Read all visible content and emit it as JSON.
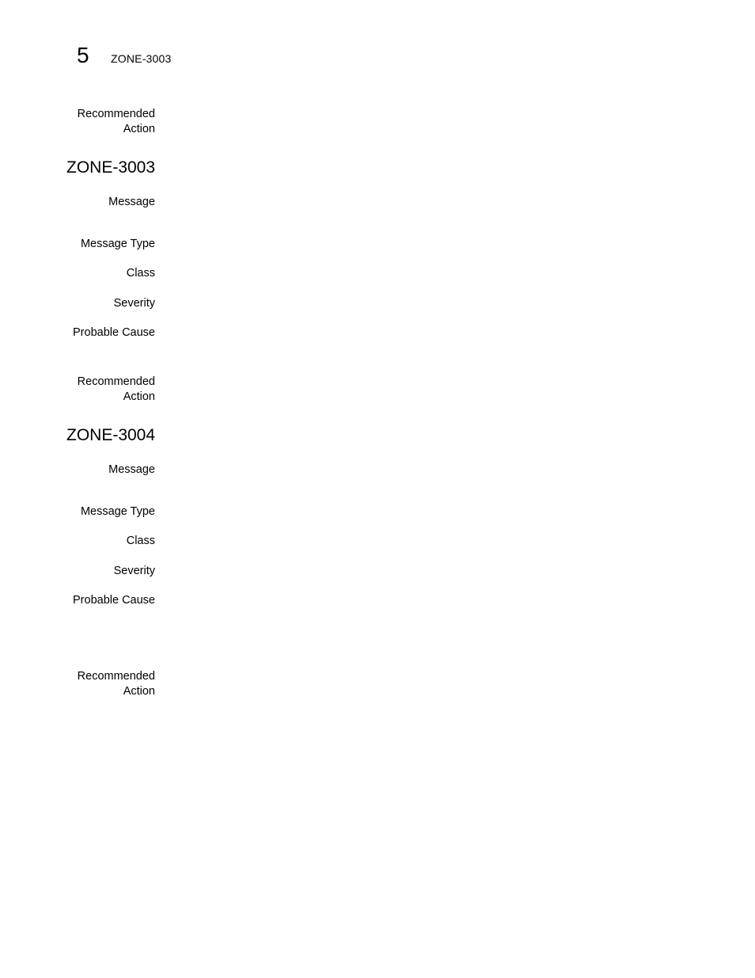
{
  "header": {
    "chapter_number": "5",
    "running_title": "ZONE-3003"
  },
  "continued_section": {
    "labels": {
      "recommended_action_line1": "Recommended",
      "recommended_action_line2": "Action"
    }
  },
  "sections": [
    {
      "title": "ZONE-3003",
      "labels": {
        "message": "Message",
        "message_type": "Message Type",
        "class": "Class",
        "severity": "Severity",
        "probable_cause": "Probable Cause",
        "recommended_action_line1": "Recommended",
        "recommended_action_line2": "Action"
      }
    },
    {
      "title": "ZONE-3004",
      "labels": {
        "message": "Message",
        "message_type": "Message Type",
        "class": "Class",
        "severity": "Severity",
        "probable_cause": "Probable Cause",
        "recommended_action_line1": "Recommended",
        "recommended_action_line2": "Action"
      }
    }
  ]
}
